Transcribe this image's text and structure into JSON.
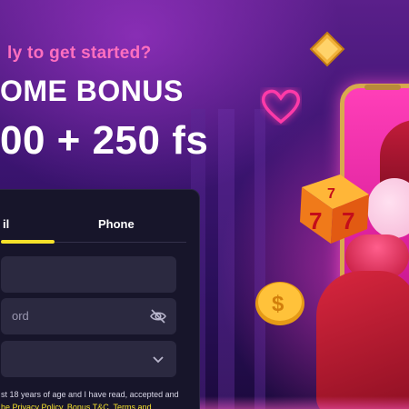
{
  "promo": {
    "subtitle": "ly to get started?",
    "bonus_title": "OME BONUS",
    "bonus_amount": "00 + 250 fs"
  },
  "form": {
    "tabs": [
      {
        "label": "il",
        "active": true
      },
      {
        "label": "Phone",
        "active": false
      }
    ],
    "email_placeholder": "",
    "password_placeholder": "ord",
    "currency_value": "",
    "consent_text": "st 18 years of age and I have read, accepted and",
    "consent_links": "he Privacy Policy, Bonus T&C, Terms and"
  },
  "colors": {
    "accent": "#f5e12a",
    "headline_pink": "#ff6fbf",
    "panel_bg": "#17152a",
    "field_bg": "#2b2940"
  },
  "icons": [
    "eye-off-icon",
    "chevron-down-icon",
    "heart-icon",
    "diamond-icon",
    "dice-icon",
    "coin-icon"
  ]
}
